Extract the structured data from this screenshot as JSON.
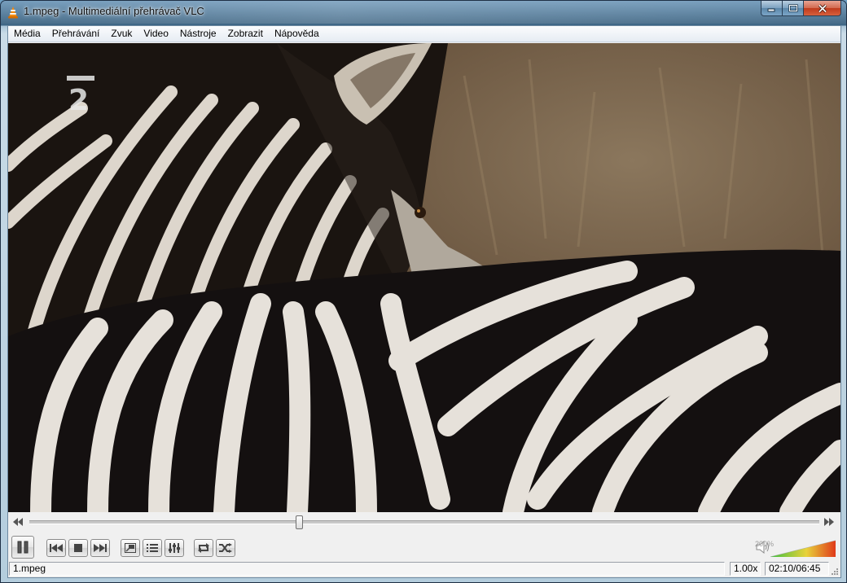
{
  "window": {
    "title": "1.mpeg - Multimediální přehrávač VLC",
    "app_icon": "vlc-cone-icon"
  },
  "menu": [
    "Média",
    "Přehrávání",
    "Zvuk",
    "Video",
    "Nástroje",
    "Zobrazit",
    "Nápověda"
  ],
  "video": {
    "description": "zebras close-up",
    "channel_logo": "ČT2"
  },
  "seek": {
    "progress": 0.341
  },
  "controls": {
    "pause_icon": "pause-icon",
    "prev_icon": "previous-icon",
    "stop_icon": "stop-icon",
    "next_icon": "next-icon",
    "fullscreen_icon": "fullscreen-icon",
    "playlist_icon": "playlist-icon",
    "extended_icon": "extended-settings-icon",
    "loop_icon": "loop-icon",
    "random_icon": "shuffle-icon"
  },
  "volume": {
    "max_label": "200%",
    "level": 1.0,
    "icon": "speaker-icon"
  },
  "status": {
    "file": "1.mpeg",
    "speed": "1.00x",
    "time": "02:10/06:45"
  },
  "colors": {
    "accent": "#3d6482",
    "volume_start": "#3fbf3f",
    "volume_end": "#e03a1a"
  }
}
